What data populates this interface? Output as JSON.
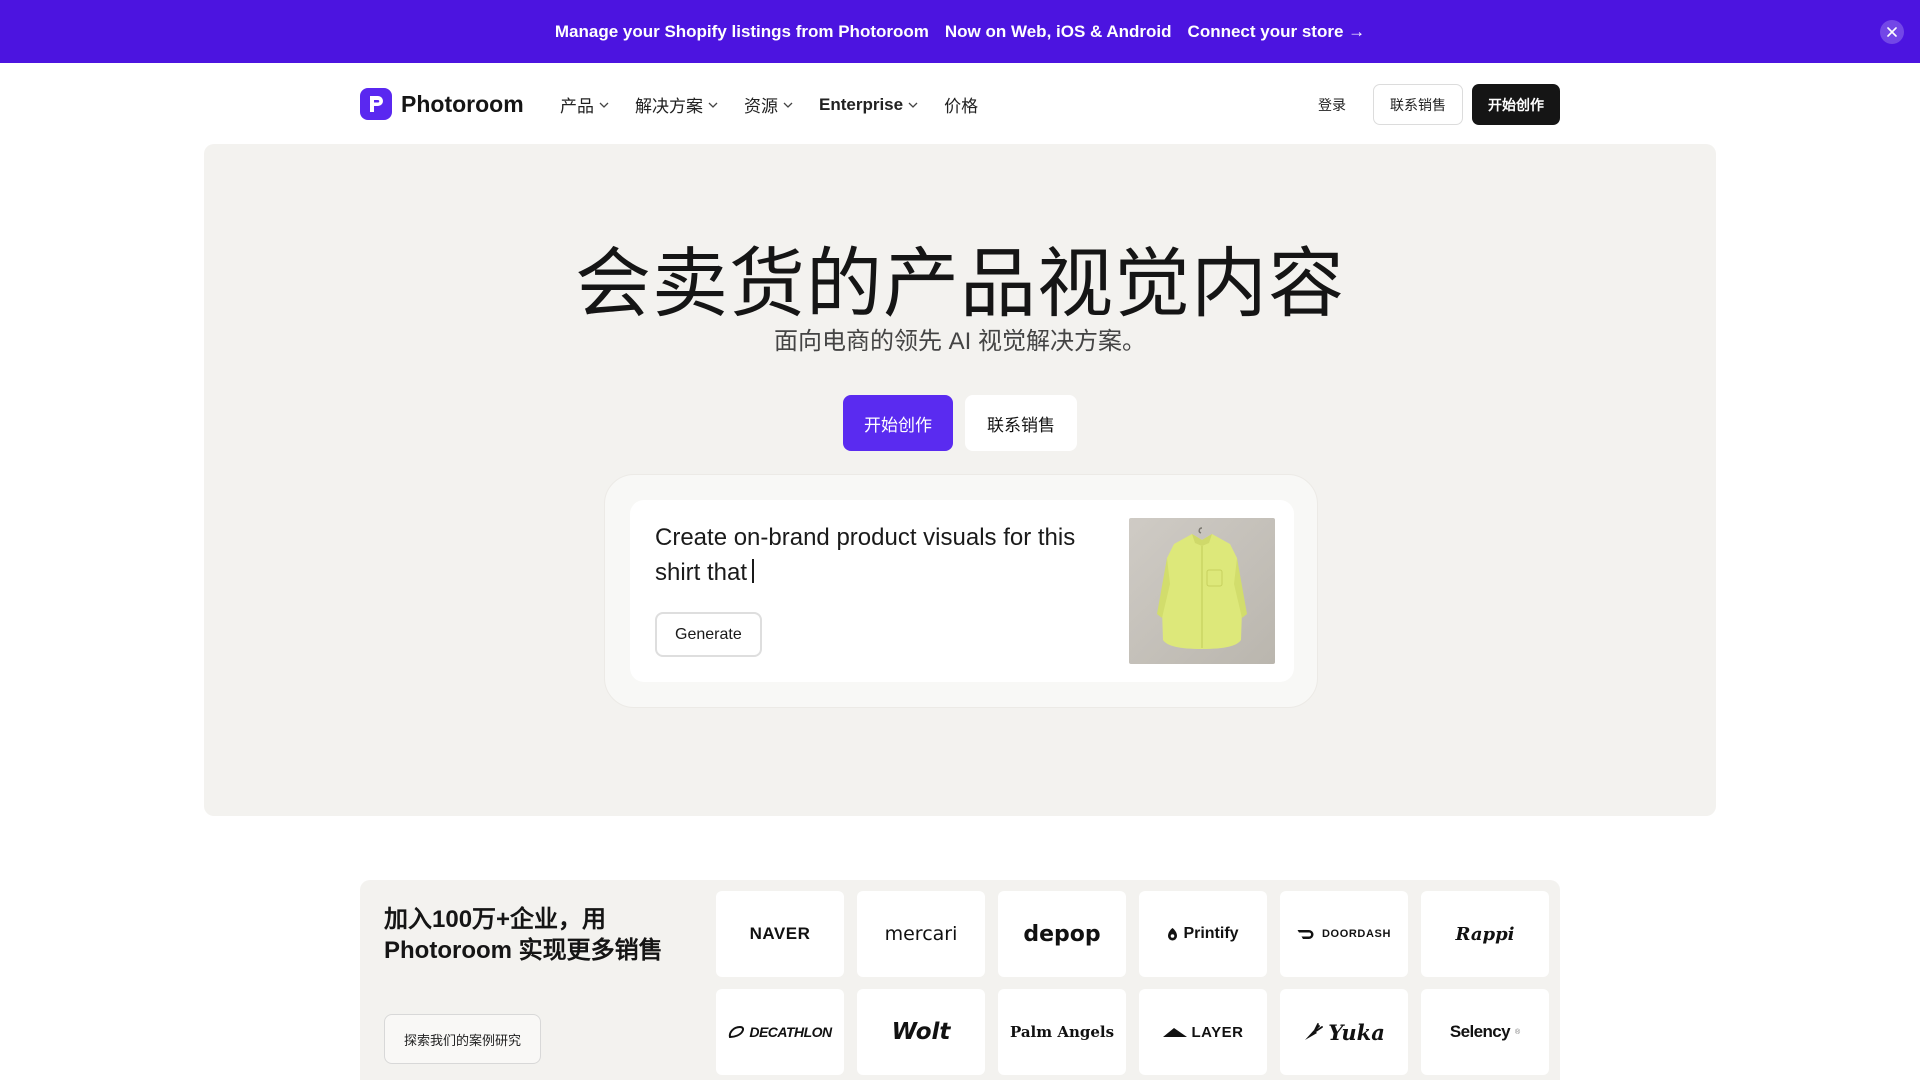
{
  "colors": {
    "banner_bg": "#4c14e0",
    "primary": "#5a2bf0",
    "dark": "#151515",
    "hero_bg": "#f3f2ef",
    "shirt": "#dde87a"
  },
  "banner": {
    "message": "Manage your Shopify listings from Photoroom",
    "platforms": "Now on Web, iOS & Android",
    "cta": "Connect your store →",
    "close_icon": "close-icon"
  },
  "nav": {
    "brand": "Photoroom",
    "brand_icon": "photoroom-logo-icon",
    "menu": [
      {
        "label": "产品",
        "has_dropdown": true
      },
      {
        "label": "解决方案",
        "has_dropdown": true
      },
      {
        "label": "资源",
        "has_dropdown": true
      },
      {
        "label": "Enterprise",
        "has_dropdown": true
      },
      {
        "label": "价格",
        "has_dropdown": false
      }
    ],
    "login": "登录",
    "contact_sales": "联系销售",
    "start_creating": "开始创作"
  },
  "hero": {
    "title": "会卖货的产品视觉内容",
    "subtitle": "面向电商的领先 AI 视觉解决方案。",
    "primary_cta": "开始创作",
    "secondary_cta": "联系销售",
    "prompt": {
      "text": "Create on-brand product visuals for this shirt that",
      "button": "Generate",
      "thumbnail": "yellow-shirt-image"
    }
  },
  "social_proof": {
    "heading": "加入100万+企业，用 Photoroom 实现更多销售",
    "button": "探索我们的案例研究",
    "logos": [
      {
        "name": "NAVER",
        "icon": ""
      },
      {
        "name": "mercari",
        "icon": ""
      },
      {
        "name": "depop",
        "icon": ""
      },
      {
        "name": "Printify",
        "icon": "printify-icon"
      },
      {
        "name": "DOORDASH",
        "icon": "doordash-icon"
      },
      {
        "name": "Rappi",
        "icon": ""
      },
      {
        "name": "DECATHLON",
        "icon": "decathlon-icon"
      },
      {
        "name": "Wolt",
        "icon": ""
      },
      {
        "name": "Palm Angels",
        "icon": ""
      },
      {
        "name": "LAYER",
        "icon": "layer-icon"
      },
      {
        "name": "Yuka",
        "icon": "carrot-icon"
      },
      {
        "name": "Selency",
        "icon": ""
      }
    ]
  }
}
